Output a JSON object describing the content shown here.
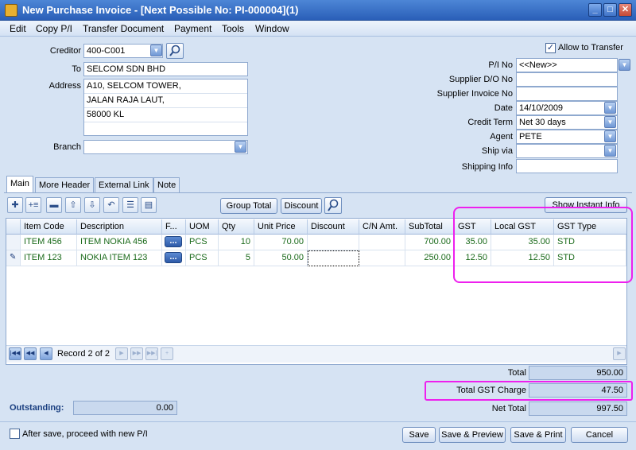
{
  "window": {
    "title": "New Purchase Invoice - [Next Possible No: PI-000004](1)"
  },
  "menu": [
    "Edit",
    "Copy P/I",
    "Transfer Document",
    "Payment",
    "Tools",
    "Window"
  ],
  "header_left": {
    "creditor_label": "Creditor",
    "creditor_value": "400-C001",
    "to_label": "To",
    "to_value": "SELCOM SDN BHD",
    "address_label": "Address",
    "address_lines": [
      "A10, SELCOM TOWER,",
      "JALAN RAJA LAUT,",
      "58000 KL",
      ""
    ],
    "branch_label": "Branch",
    "branch_value": ""
  },
  "header_right": {
    "allow_transfer_label": "Allow to Transfer",
    "allow_transfer_checked": true,
    "pi_no_label": "P/I No",
    "pi_no_value": "<<New>>",
    "supplier_do_label": "Supplier D/O No",
    "supplier_do_value": "",
    "supplier_inv_label": "Supplier Invoice No",
    "supplier_inv_value": "",
    "date_label": "Date",
    "date_value": "14/10/2009",
    "credit_term_label": "Credit Term",
    "credit_term_value": "Net 30 days",
    "agent_label": "Agent",
    "agent_value": "PETE",
    "ship_via_label": "Ship via",
    "ship_via_value": "",
    "shipping_info_label": "Shipping Info",
    "shipping_info_value": ""
  },
  "tabs": [
    "Main",
    "More Header",
    "External Link",
    "Note"
  ],
  "toolbar": {
    "group_total": "Group Total",
    "discount": "Discount",
    "show_instant_info": "Show Instant Info"
  },
  "grid": {
    "columns": [
      "Item Code",
      "Description",
      "F...",
      "UOM",
      "Qty",
      "Unit Price",
      "Discount",
      "C/N Amt.",
      "SubTotal",
      "GST",
      "Local GST",
      "GST Type"
    ],
    "rows": [
      {
        "item_code": "ITEM 456",
        "description": "ITEM NOKIA 456",
        "uom": "PCS",
        "qty": "10",
        "unit_price": "70.00",
        "discount": "",
        "cn_amt": "",
        "subtotal": "700.00",
        "gst": "35.00",
        "local_gst": "35.00",
        "gst_type": "STD"
      },
      {
        "item_code": "ITEM 123",
        "description": "NOKIA ITEM 123",
        "uom": "PCS",
        "qty": "5",
        "unit_price": "50.00",
        "discount": "",
        "cn_amt": "",
        "subtotal": "250.00",
        "gst": "12.50",
        "local_gst": "12.50",
        "gst_type": "STD"
      }
    ],
    "ellipsis": "..."
  },
  "navigator": {
    "record_text": "Record 2 of 2"
  },
  "totals": {
    "total_label": "Total",
    "total_value": "950.00",
    "gst_label": "Total GST Charge",
    "gst_value": "47.50",
    "net_label": "Net Total",
    "net_value": "997.50"
  },
  "outstanding": {
    "label": "Outstanding:",
    "value": "0.00"
  },
  "footer": {
    "after_save_label": "After save, proceed with new P/I",
    "after_save_checked": false,
    "save": "Save",
    "save_preview": "Save & Preview",
    "save_print": "Save & Print",
    "cancel": "Cancel"
  },
  "colors": {
    "highlight": "#ee20ee",
    "titlebar": "#2a5fb8",
    "row_text": "#1a6a1a",
    "outstanding_label": "#1a3f80"
  }
}
